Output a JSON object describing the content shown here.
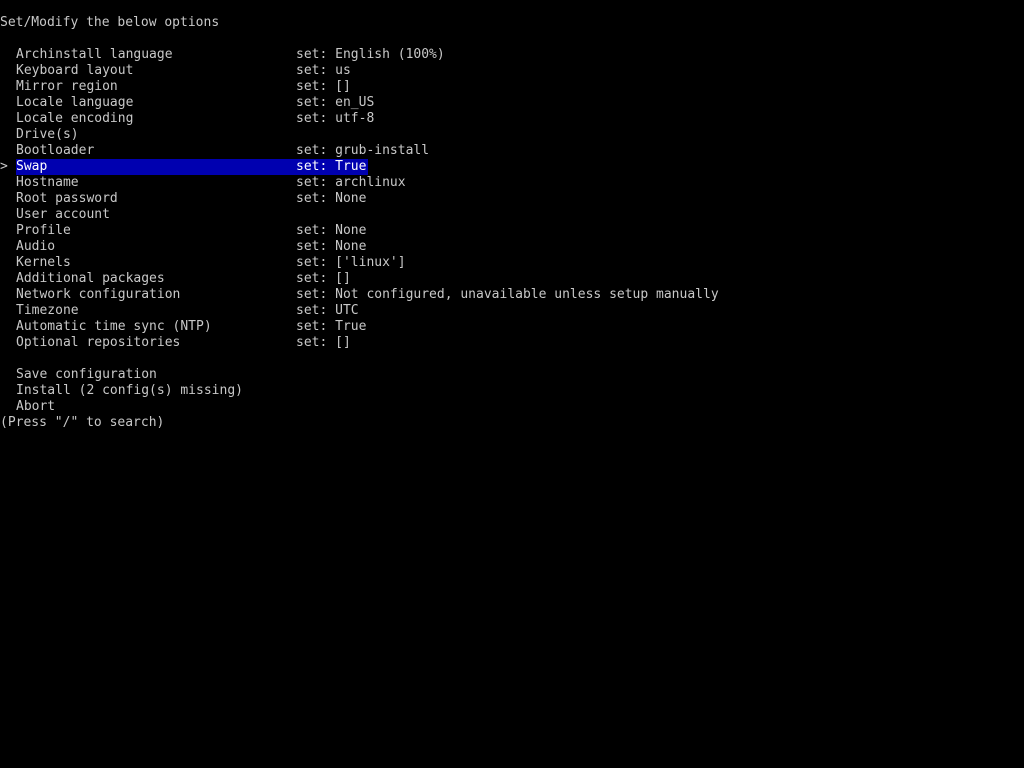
{
  "header": "Set/Modify the below options",
  "cursor_symbol": ">",
  "menu": [
    {
      "label": "Archinstall language",
      "value": "set: English (100%)"
    },
    {
      "label": "Keyboard layout",
      "value": "set: us"
    },
    {
      "label": "Mirror region",
      "value": "set: []"
    },
    {
      "label": "Locale language",
      "value": "set: en_US"
    },
    {
      "label": "Locale encoding",
      "value": "set: utf-8"
    },
    {
      "label": "Drive(s)",
      "value": ""
    },
    {
      "label": "Bootloader",
      "value": "set: grub-install"
    },
    {
      "label": "Swap",
      "value": "set: True",
      "selected": true
    },
    {
      "label": "Hostname",
      "value": "set: archlinux"
    },
    {
      "label": "Root password",
      "value": "set: None"
    },
    {
      "label": "User account",
      "value": ""
    },
    {
      "label": "Profile",
      "value": "set: None"
    },
    {
      "label": "Audio",
      "value": "set: None"
    },
    {
      "label": "Kernels",
      "value": "set: ['linux']"
    },
    {
      "label": "Additional packages",
      "value": "set: []"
    },
    {
      "label": "Network configuration",
      "value": "set: Not configured, unavailable unless setup manually"
    },
    {
      "label": "Timezone",
      "value": "set: UTC"
    },
    {
      "label": "Automatic time sync (NTP)",
      "value": "set: True"
    },
    {
      "label": "Optional repositories",
      "value": "set: []"
    }
  ],
  "actions": [
    {
      "label": "Save configuration"
    },
    {
      "label": "Install (2 config(s) missing)"
    },
    {
      "label": "Abort"
    }
  ],
  "footer": "(Press \"/\" to search)",
  "colors": {
    "background": "#000000",
    "text": "#c8c8c8",
    "highlight": "#0000b0",
    "highlight_text": "#ffffff"
  }
}
